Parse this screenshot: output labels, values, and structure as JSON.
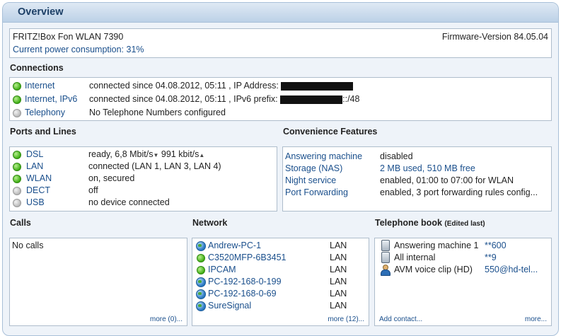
{
  "header": {
    "title": "Overview"
  },
  "device": {
    "name": "FRITZ!Box Fon WLAN 7390",
    "firmware": "Firmware-Version 84.05.04",
    "power": "Current power consumption: 31%"
  },
  "connections": {
    "title": "Connections",
    "items": [
      {
        "label": "Internet",
        "status": "connected since 04.08.2012, 05:11",
        "extra": ", IP Address:",
        "suffix": "",
        "state": "green"
      },
      {
        "label": "Internet, IPv6",
        "status": "connected since 04.08.2012, 05:11",
        "extra": ", IPv6 prefix:",
        "suffix": "::/48",
        "state": "green"
      },
      {
        "label": "Telephony",
        "status": "No Telephone Numbers configured",
        "extra": "",
        "suffix": "",
        "state": "gray"
      }
    ]
  },
  "ports": {
    "title": "Ports and Lines",
    "items": [
      {
        "label": "DSL",
        "status": "ready, 6,8 Mbit/s",
        "down_icon": "arrow-down-icon",
        "up_value": "991 kbit/s",
        "up_icon": "arrow-up-icon",
        "state": "green"
      },
      {
        "label": "LAN",
        "status": "connected (LAN 1, LAN 3, LAN 4)",
        "state": "green"
      },
      {
        "label": "WLAN",
        "status": "on, secured",
        "state": "green"
      },
      {
        "label": "DECT",
        "status": "off",
        "state": "gray"
      },
      {
        "label": "USB",
        "status": "no device connected",
        "state": "gray"
      }
    ]
  },
  "convenience": {
    "title": "Convenience Features",
    "items": [
      {
        "label": "Answering machine",
        "value": "disabled"
      },
      {
        "label": "Storage (NAS)",
        "value": "2 MB used, 510 MB free"
      },
      {
        "label": "Night service",
        "value": "enabled, 01:00 to 07:00 for WLAN"
      },
      {
        "label": "Port Forwarding",
        "value": "enabled, 3 port forwarding rules config..."
      }
    ]
  },
  "calls": {
    "title": "Calls",
    "empty": "No calls",
    "more": "more (0)..."
  },
  "network": {
    "title": "Network",
    "items": [
      {
        "name": "Andrew-PC-1",
        "type": "LAN",
        "icon": "globe"
      },
      {
        "name": "C3520MFP-6B3451",
        "type": "LAN",
        "icon": "dot"
      },
      {
        "name": "IPCAM",
        "type": "LAN",
        "icon": "dot"
      },
      {
        "name": "PC-192-168-0-199",
        "type": "LAN",
        "icon": "globe"
      },
      {
        "name": "PC-192-168-0-69",
        "type": "LAN",
        "icon": "globe"
      },
      {
        "name": "SureSignal",
        "type": "LAN",
        "icon": "globe"
      }
    ],
    "more": "more (12)..."
  },
  "phonebook": {
    "title": "Telephone book",
    "subtitle": "(Edited last)",
    "items": [
      {
        "name": "Answering machine 1",
        "number": "**600",
        "icon": "phone"
      },
      {
        "name": "All internal",
        "number": "**9",
        "icon": "phone"
      },
      {
        "name": "AVM voice clip (HD)",
        "number": "550@hd-tel...",
        "icon": "person"
      }
    ],
    "add": "Add contact...",
    "more": "more..."
  }
}
